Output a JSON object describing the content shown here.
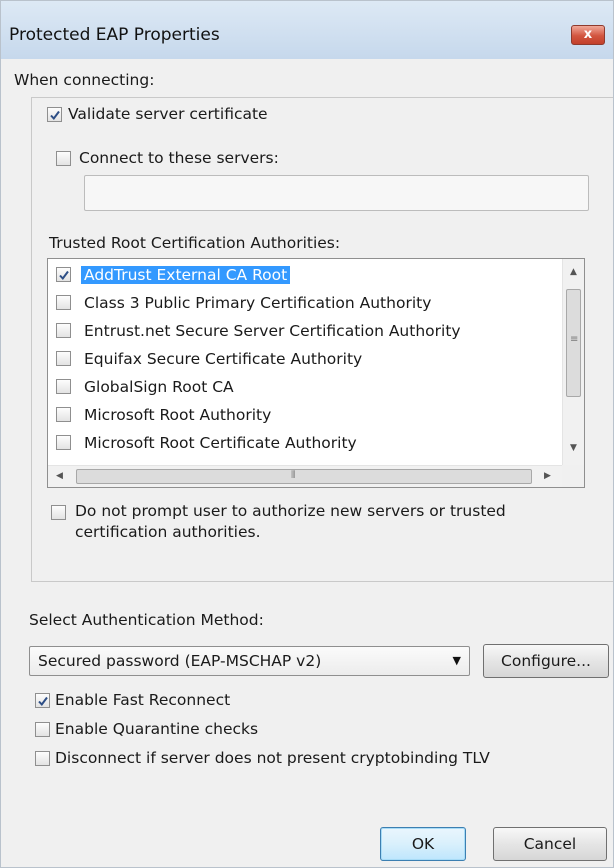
{
  "window": {
    "title": "Protected EAP Properties",
    "close_label": "x"
  },
  "when_connecting": {
    "label": "When connecting:"
  },
  "validate": {
    "label": "Validate server certificate",
    "checked": true
  },
  "connect_servers": {
    "label": "Connect to these servers:",
    "checked": false,
    "value": ""
  },
  "trusted": {
    "label": "Trusted Root Certification Authorities:",
    "items": [
      {
        "label": "AddTrust External CA Root",
        "checked": true,
        "selected": true
      },
      {
        "label": "Class 3 Public Primary Certification Authority",
        "checked": false
      },
      {
        "label": "Entrust.net Secure Server Certification Authority",
        "checked": false
      },
      {
        "label": "Equifax Secure Certificate Authority",
        "checked": false
      },
      {
        "label": "GlobalSign Root CA",
        "checked": false
      },
      {
        "label": "Microsoft Root Authority",
        "checked": false
      },
      {
        "label": "Microsoft Root Certificate Authority",
        "checked": false
      }
    ]
  },
  "no_prompt": {
    "line1": "Do not prompt user to authorize new servers or trusted",
    "line2": "certification authorities.",
    "checked": false
  },
  "auth": {
    "label": "Select Authentication Method:",
    "selected": "Secured password (EAP-MSCHAP v2)",
    "configure_label": "Configure..."
  },
  "options": [
    {
      "label": "Enable Fast Reconnect",
      "checked": true
    },
    {
      "label": "Enable Quarantine checks",
      "checked": false
    },
    {
      "label": "Disconnect if server does not present cryptobinding TLV",
      "checked": false
    }
  ],
  "buttons": {
    "ok": "OK",
    "cancel": "Cancel"
  },
  "icons": {
    "close": "close-icon",
    "check": "checkmark-icon",
    "dropdown": "chevron-down-icon"
  }
}
